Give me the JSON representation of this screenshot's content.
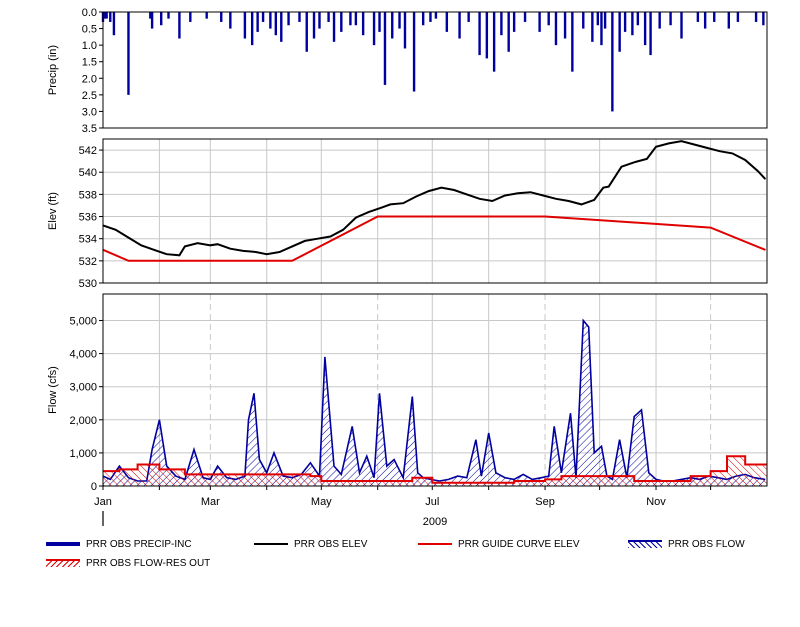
{
  "chart_data": [
    {
      "type": "bar",
      "ylabel": "Precip (in)",
      "ylim": [
        0,
        3.5
      ],
      "inverted": true,
      "yticks": [
        "0.0",
        "0.5",
        "1.0",
        "1.5",
        "2.0",
        "2.5",
        "3.0",
        "3.5"
      ],
      "series": [
        {
          "name": "PRR OBS PRECIP-INC",
          "color": "#0000a0",
          "x": [
            "2009-01-01",
            "2009-01-02",
            "2009-01-03",
            "2009-01-05",
            "2009-01-07",
            "2009-01-15",
            "2009-01-27",
            "2009-01-28",
            "2009-02-02",
            "2009-02-06",
            "2009-02-12",
            "2009-02-18",
            "2009-02-27",
            "2009-03-07",
            "2009-03-12",
            "2009-03-20",
            "2009-03-24",
            "2009-03-27",
            "2009-03-30",
            "2009-04-03",
            "2009-04-06",
            "2009-04-09",
            "2009-04-13",
            "2009-04-19",
            "2009-04-23",
            "2009-04-27",
            "2009-04-30",
            "2009-05-05",
            "2009-05-08",
            "2009-05-12",
            "2009-05-17",
            "2009-05-20",
            "2009-05-24",
            "2009-05-30",
            "2009-06-02",
            "2009-06-05",
            "2009-06-09",
            "2009-06-13",
            "2009-06-16",
            "2009-06-21",
            "2009-06-26",
            "2009-06-30",
            "2009-07-03",
            "2009-07-09",
            "2009-07-16",
            "2009-07-21",
            "2009-07-27",
            "2009-07-31",
            "2009-08-04",
            "2009-08-08",
            "2009-08-12",
            "2009-08-15",
            "2009-08-21",
            "2009-08-29",
            "2009-09-03",
            "2009-09-07",
            "2009-09-12",
            "2009-09-16",
            "2009-09-22",
            "2009-09-27",
            "2009-09-30",
            "2009-10-02",
            "2009-10-04",
            "2009-10-08",
            "2009-10-12",
            "2009-10-15",
            "2009-10-19",
            "2009-10-22",
            "2009-10-26",
            "2009-10-29",
            "2009-11-03",
            "2009-11-09",
            "2009-11-15",
            "2009-11-24",
            "2009-11-28",
            "2009-12-03",
            "2009-12-11",
            "2009-12-16",
            "2009-12-26",
            "2009-12-30"
          ],
          "values": [
            0.3,
            0.2,
            0.2,
            0.3,
            0.7,
            2.5,
            0.2,
            0.5,
            0.4,
            0.2,
            0.8,
            0.3,
            0.2,
            0.3,
            0.5,
            0.8,
            1.0,
            0.6,
            0.3,
            0.5,
            0.7,
            0.9,
            0.4,
            0.3,
            1.2,
            0.8,
            0.5,
            0.3,
            0.9,
            0.6,
            0.4,
            0.4,
            0.7,
            1.0,
            0.6,
            2.2,
            0.8,
            0.5,
            1.1,
            2.4,
            0.4,
            0.3,
            0.2,
            0.6,
            0.8,
            0.3,
            1.3,
            1.4,
            1.8,
            0.7,
            1.2,
            0.6,
            0.3,
            0.6,
            0.4,
            1.0,
            0.8,
            1.8,
            0.5,
            0.9,
            0.4,
            1.0,
            0.5,
            3.0,
            1.2,
            0.6,
            0.7,
            0.4,
            1.0,
            1.3,
            0.5,
            0.4,
            0.8,
            0.3,
            0.5,
            0.3,
            0.5,
            0.3,
            0.3,
            0.4
          ]
        }
      ]
    },
    {
      "type": "line",
      "ylabel": "Elev (ft)",
      "ylim": [
        530,
        543
      ],
      "yticks": [
        "530",
        "532",
        "534",
        "536",
        "538",
        "540",
        "542"
      ],
      "series": [
        {
          "name": "PRR OBS ELEV",
          "color": "#000000",
          "x": [
            "2009-01-01",
            "2009-01-08",
            "2009-01-15",
            "2009-01-22",
            "2009-01-29",
            "2009-02-05",
            "2009-02-12",
            "2009-02-15",
            "2009-02-22",
            "2009-03-01",
            "2009-03-05",
            "2009-03-12",
            "2009-03-19",
            "2009-03-26",
            "2009-04-01",
            "2009-04-08",
            "2009-04-15",
            "2009-04-22",
            "2009-04-29",
            "2009-05-06",
            "2009-05-13",
            "2009-05-20",
            "2009-05-27",
            "2009-06-03",
            "2009-06-08",
            "2009-06-15",
            "2009-06-22",
            "2009-06-29",
            "2009-07-06",
            "2009-07-13",
            "2009-07-20",
            "2009-07-27",
            "2009-08-03",
            "2009-08-10",
            "2009-08-17",
            "2009-08-24",
            "2009-08-31",
            "2009-09-07",
            "2009-09-14",
            "2009-09-21",
            "2009-09-28",
            "2009-10-03",
            "2009-10-06",
            "2009-10-13",
            "2009-10-20",
            "2009-10-27",
            "2009-11-01",
            "2009-11-08",
            "2009-11-15",
            "2009-11-22",
            "2009-11-29",
            "2009-12-06",
            "2009-12-13",
            "2009-12-20",
            "2009-12-27",
            "2009-12-31"
          ],
          "values": [
            535.2,
            534.8,
            534.1,
            533.4,
            533.0,
            532.6,
            532.5,
            533.3,
            533.6,
            533.4,
            533.5,
            533.1,
            532.9,
            532.8,
            532.6,
            532.8,
            533.3,
            533.8,
            534.0,
            534.2,
            534.8,
            535.9,
            536.4,
            536.8,
            537.1,
            537.2,
            537.8,
            538.3,
            538.6,
            538.4,
            538.0,
            537.6,
            537.4,
            537.9,
            538.1,
            538.2,
            537.9,
            537.6,
            537.4,
            537.1,
            537.5,
            538.6,
            538.7,
            540.5,
            540.9,
            541.2,
            542.3,
            542.6,
            542.8,
            542.5,
            542.2,
            541.9,
            541.7,
            541.1,
            540.1,
            539.4
          ]
        },
        {
          "name": "PRR GUIDE CURVE ELEV",
          "color": "#e00000",
          "x": [
            "2009-01-01",
            "2009-01-15",
            "2009-04-15",
            "2009-06-01",
            "2009-09-01",
            "2009-12-01",
            "2009-12-31"
          ],
          "values": [
            533.0,
            532.0,
            532.0,
            536.0,
            536.0,
            535.0,
            533.0
          ]
        }
      ]
    },
    {
      "type": "area",
      "ylabel": "Flow (cfs)",
      "xlabel": "2009",
      "ylim": [
        0,
        5800
      ],
      "yticks": [
        "0",
        "1,000",
        "2,000",
        "3,000",
        "4,000",
        "5,000"
      ],
      "xticks": [
        "Jan",
        "Mar",
        "May",
        "Jul",
        "Sep",
        "Nov"
      ],
      "series": [
        {
          "name": "PRR OBS FLOW",
          "color": "#0000a0",
          "x": [
            "2009-01-01",
            "2009-01-05",
            "2009-01-10",
            "2009-01-15",
            "2009-01-20",
            "2009-01-25",
            "2009-01-28",
            "2009-02-01",
            "2009-02-05",
            "2009-02-10",
            "2009-02-15",
            "2009-02-20",
            "2009-02-25",
            "2009-03-01",
            "2009-03-05",
            "2009-03-10",
            "2009-03-15",
            "2009-03-20",
            "2009-03-22",
            "2009-03-25",
            "2009-03-28",
            "2009-04-01",
            "2009-04-05",
            "2009-04-10",
            "2009-04-15",
            "2009-04-20",
            "2009-04-25",
            "2009-04-30",
            "2009-05-03",
            "2009-05-08",
            "2009-05-12",
            "2009-05-18",
            "2009-05-22",
            "2009-05-26",
            "2009-05-30",
            "2009-06-02",
            "2009-06-06",
            "2009-06-10",
            "2009-06-15",
            "2009-06-20",
            "2009-06-23",
            "2009-06-26",
            "2009-06-30",
            "2009-07-05",
            "2009-07-10",
            "2009-07-15",
            "2009-07-20",
            "2009-07-25",
            "2009-07-28",
            "2009-08-01",
            "2009-08-05",
            "2009-08-10",
            "2009-08-15",
            "2009-08-20",
            "2009-08-25",
            "2009-08-30",
            "2009-09-03",
            "2009-09-06",
            "2009-09-10",
            "2009-09-15",
            "2009-09-18",
            "2009-09-22",
            "2009-09-25",
            "2009-09-28",
            "2009-10-02",
            "2009-10-05",
            "2009-10-08",
            "2009-10-12",
            "2009-10-16",
            "2009-10-20",
            "2009-10-24",
            "2009-10-28",
            "2009-11-01",
            "2009-11-05",
            "2009-11-10",
            "2009-11-15",
            "2009-11-20",
            "2009-11-25",
            "2009-11-30",
            "2009-12-05",
            "2009-12-10",
            "2009-12-15",
            "2009-12-20",
            "2009-12-25",
            "2009-12-31"
          ],
          "values": [
            300,
            200,
            600,
            250,
            150,
            150,
            1100,
            2000,
            600,
            300,
            200,
            1100,
            250,
            200,
            600,
            250,
            200,
            300,
            2000,
            2800,
            800,
            400,
            1000,
            300,
            250,
            350,
            700,
            300,
            3900,
            600,
            350,
            1800,
            400,
            900,
            250,
            2800,
            600,
            800,
            250,
            2700,
            400,
            250,
            200,
            150,
            200,
            300,
            250,
            1400,
            300,
            1600,
            400,
            250,
            200,
            350,
            200,
            250,
            300,
            1800,
            400,
            2200,
            250,
            5000,
            4800,
            1000,
            1200,
            300,
            200,
            1400,
            250,
            2100,
            2300,
            400,
            200,
            150,
            150,
            200,
            250,
            200,
            300,
            250,
            200,
            300,
            350,
            250,
            200
          ]
        },
        {
          "name": "PRR OBS FLOW-RES OUT",
          "color": "#e00000",
          "x": [
            "2009-01-01",
            "2009-01-10",
            "2009-01-20",
            "2009-02-01",
            "2009-02-15",
            "2009-03-01",
            "2009-04-01",
            "2009-04-25",
            "2009-05-01",
            "2009-06-01",
            "2009-06-20",
            "2009-07-01",
            "2009-08-01",
            "2009-08-15",
            "2009-09-01",
            "2009-09-10",
            "2009-10-01",
            "2009-10-20",
            "2009-11-01",
            "2009-11-20",
            "2009-12-01",
            "2009-12-10",
            "2009-12-20",
            "2009-12-31"
          ],
          "values": [
            450,
            500,
            650,
            500,
            350,
            350,
            350,
            300,
            150,
            150,
            250,
            100,
            100,
            150,
            200,
            300,
            300,
            150,
            150,
            300,
            450,
            900,
            650,
            650
          ]
        }
      ]
    }
  ],
  "legend": [
    {
      "label": "PRR OBS PRECIP-INC",
      "style": "bar",
      "color": "#0000a0"
    },
    {
      "label": "PRR OBS ELEV",
      "style": "line",
      "color": "#000000"
    },
    {
      "label": "PRR GUIDE CURVE ELEV",
      "style": "line",
      "color": "#e00000"
    },
    {
      "label": "PRR OBS FLOW",
      "style": "hatch",
      "color": "#0000a0"
    },
    {
      "label": "PRR OBS FLOW-RES OUT",
      "style": "hatch",
      "color": "#e00000"
    }
  ]
}
